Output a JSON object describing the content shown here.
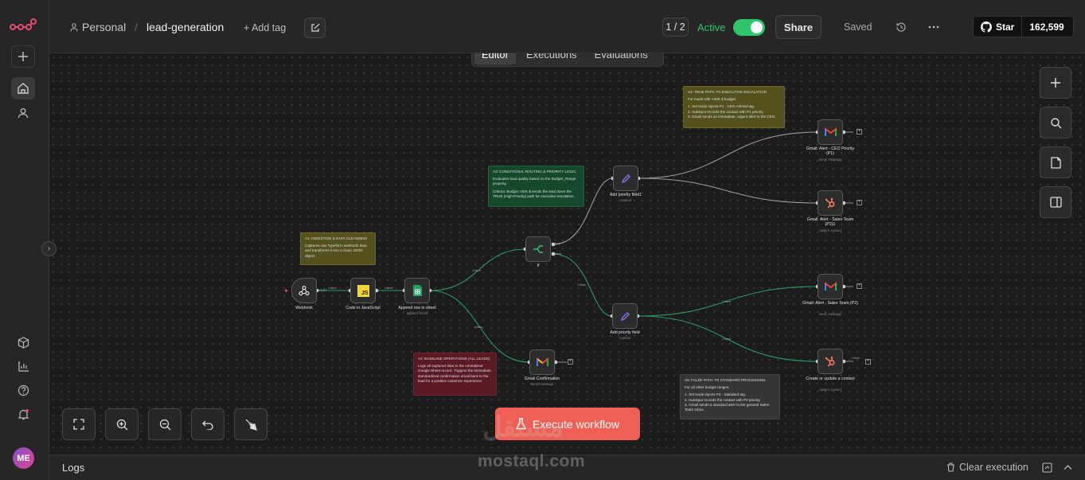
{
  "header": {
    "workspace": "Personal",
    "separator": "/",
    "workflow_name": "lead-generation",
    "add_tag": "+ Add tag",
    "version": "1 / 2",
    "active_label": "Active",
    "share_label": "Share",
    "saved_label": "Saved",
    "github_star": "Star",
    "github_count": "162,599"
  },
  "tabs": [
    "Editor",
    "Executions",
    "Evaluations"
  ],
  "notes": {
    "a1": {
      "title": "A1: INGESTION & DATA CLEANSING",
      "body": "Captures raw Typeform webhook data and transforms it into a clean JSON object."
    },
    "a2": {
      "title": "A2: BASELINE OPERATIONS (ALL LEADS)",
      "body": "Logs all captured data to the centralized Google Sheet record. Triggers the immediate, standardized confirmation email back to the lead for a positive customer experience."
    },
    "a3": {
      "title": "A3: CONDITIONAL ROUTING & PRIORITY LOGIC",
      "body1": "Evaluates lead quality based on the Budget_Range property.",
      "body2": "Criteria: Budget >30K $ sends the lead down the TRUE (High-Priority) path for executive escalation."
    },
    "a4": {
      "title": "A4: TRUE PATH: P1 EXECUTIVE ESCALATION",
      "body": "For leads with >30K $ budget.",
      "items": [
        "1. Set Node injects P1 - CEO Alerted tag.",
        "2. HubSpot records the contact with P1 priority.",
        "3. Gmail sends an immediate, urgent alert to the CEO."
      ]
    },
    "a5": {
      "title": "A5: FALSE PATH: P2 STANDARD PROCESSING",
      "body": "For all other budget ranges.",
      "items": [
        "1. Set Node injects P2 - Standard tag.",
        "2. HubSpot records the contact with P2 priority.",
        "3. Gmail sends a standard alert to the general Sales Team inbox."
      ]
    }
  },
  "nodes": {
    "webhook": {
      "label": "Webhook"
    },
    "code": {
      "label": "Code in JavaScript"
    },
    "sheet": {
      "label": "Append row in sheet",
      "sub": "append: sheet"
    },
    "if": {
      "label": "If",
      "true_label": "true",
      "false_label": "false"
    },
    "gmail_confirm": {
      "label": "Gmail Confirmation",
      "sub": "send: message"
    },
    "priority_top": {
      "label": "Add priority field1",
      "sub": "manual"
    },
    "priority_bottom": {
      "label": "Add priority field",
      "sub": "manual"
    },
    "gmail_ceo": {
      "label": "Gmail: Alert - CEO Priority (P1)",
      "sub": "send: message"
    },
    "hubspot_top": {
      "label": "Gmail: Alert - Sales Team (P2)1",
      "sub": "upsert: contact"
    },
    "gmail_p2": {
      "label": "Gmail: Alert - Sales Team (P2)",
      "sub": "send: message"
    },
    "hubspot_bottom": {
      "label": "Create or update a contact",
      "sub": "upsert: contact"
    }
  },
  "edges": {
    "post": "POST",
    "one_item": "1 item"
  },
  "execute_label": "Execute workflow",
  "logs": {
    "label": "Logs",
    "clear": "Clear execution"
  },
  "avatar_initials": "ME",
  "watermark": {
    "latin": "mostaql.com",
    "arabic": "مستقل"
  },
  "colors": {
    "accent": "#ef5f56",
    "active": "#2fc56d",
    "edge": "#2a9a66"
  }
}
